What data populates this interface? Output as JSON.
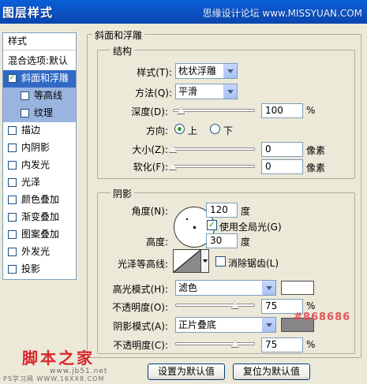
{
  "window": {
    "title": "图层样式",
    "watermark": "思缘设计论坛  www.MISSYUAN.COM"
  },
  "style_list": {
    "header": "样式",
    "items": [
      {
        "label": "混合选项:默认",
        "checkbox": false,
        "checked": false,
        "selected": false,
        "indent": false,
        "sub": false
      },
      {
        "label": "斜面和浮雕",
        "checkbox": true,
        "checked": true,
        "selected": true,
        "indent": false,
        "sub": false
      },
      {
        "label": "等高线",
        "checkbox": true,
        "checked": false,
        "selected": false,
        "indent": true,
        "sub": true
      },
      {
        "label": "纹理",
        "checkbox": true,
        "checked": false,
        "selected": false,
        "indent": true,
        "sub": true
      },
      {
        "label": "描边",
        "checkbox": true,
        "checked": false,
        "selected": false,
        "indent": false,
        "sub": false
      },
      {
        "label": "内阴影",
        "checkbox": true,
        "checked": false,
        "selected": false,
        "indent": false,
        "sub": false
      },
      {
        "label": "内发光",
        "checkbox": true,
        "checked": false,
        "selected": false,
        "indent": false,
        "sub": false
      },
      {
        "label": "光泽",
        "checkbox": true,
        "checked": false,
        "selected": false,
        "indent": false,
        "sub": false
      },
      {
        "label": "颜色叠加",
        "checkbox": true,
        "checked": false,
        "selected": false,
        "indent": false,
        "sub": false
      },
      {
        "label": "渐变叠加",
        "checkbox": true,
        "checked": false,
        "selected": false,
        "indent": false,
        "sub": false
      },
      {
        "label": "图案叠加",
        "checkbox": true,
        "checked": false,
        "selected": false,
        "indent": false,
        "sub": false
      },
      {
        "label": "外发光",
        "checkbox": true,
        "checked": false,
        "selected": false,
        "indent": false,
        "sub": false
      },
      {
        "label": "投影",
        "checkbox": true,
        "checked": false,
        "selected": false,
        "indent": false,
        "sub": false
      }
    ]
  },
  "bevel": {
    "title": "斜面和浮雕",
    "structure": {
      "title": "结构",
      "style_label": "样式(T):",
      "style_value": "枕状浮雕",
      "method_label": "方法(Q):",
      "method_value": "平滑",
      "depth_label": "深度(D):",
      "depth_value": "100",
      "depth_unit": "%",
      "depth_fraction": 0.1,
      "direction_label": "方向:",
      "direction_up": "上",
      "direction_down": "下",
      "direction_selected": "上",
      "size_label": "大小(Z):",
      "size_value": "0",
      "size_unit": "像素",
      "soften_label": "软化(F):",
      "soften_value": "0",
      "soften_unit": "像素"
    },
    "shading": {
      "title": "阴影",
      "angle_label": "角度(N):",
      "angle_value": "120",
      "angle_unit": "度",
      "global_light_label": "使用全局光(G)",
      "global_light_checked": true,
      "altitude_label": "高度:",
      "altitude_value": "30",
      "altitude_unit": "度",
      "gloss_contour_label": "光泽等高线:",
      "anti_alias_label": "消除锯齿(L)",
      "anti_alias_checked": false,
      "highlight_mode_label": "高光模式(H):",
      "highlight_mode_value": "滤色",
      "highlight_color": "#ffffff",
      "highlight_opacity_label": "不透明度(O):",
      "highlight_opacity_value": "75",
      "highlight_opacity_unit": "%",
      "highlight_opacity_fraction": 0.75,
      "shadow_mode_label": "阴影模式(A):",
      "shadow_mode_value": "正片叠底",
      "shadow_color": "#868686",
      "shadow_opacity_label": "不透明度(C):",
      "shadow_opacity_value": "75",
      "shadow_opacity_unit": "%",
      "shadow_opacity_fraction": 0.75
    }
  },
  "buttons": {
    "make_default": "设置为默认值",
    "reset_default": "复位为默认值"
  },
  "watermarks": {
    "hex_code": "#868686",
    "brand": "脚本之家",
    "url": "www.jb51.net",
    "ps_url": "PS学习网 WWW.16XX8.COM"
  }
}
